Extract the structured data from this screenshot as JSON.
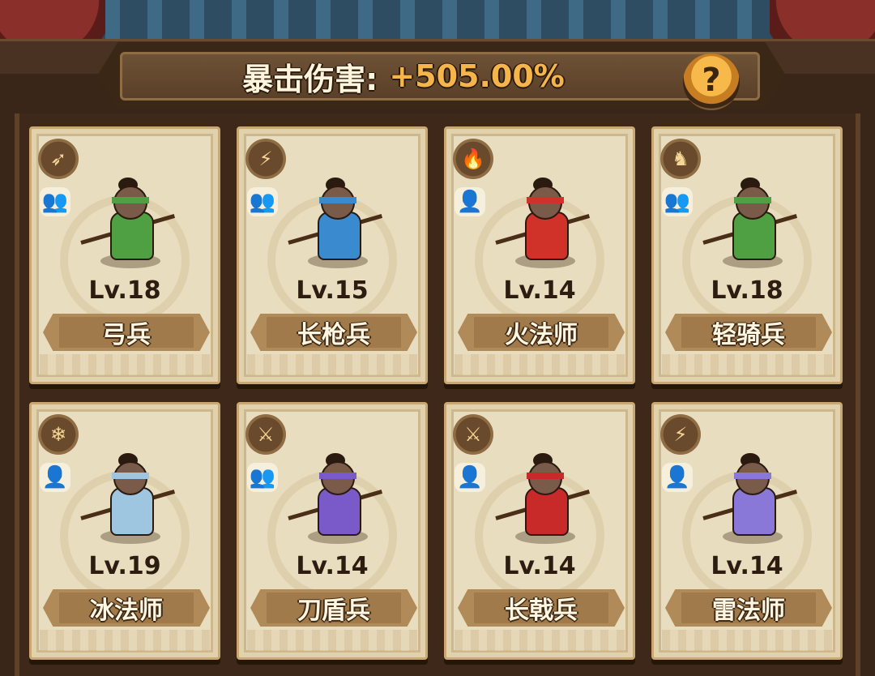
{
  "header": {
    "stat_label": "暴击伤害:",
    "stat_value": "+505.00%",
    "help_icon": "question-mark-icon",
    "help_symbol": "?"
  },
  "units": [
    {
      "level": "Lv.18",
      "name": "弓兵",
      "class_icon": "bow-icon",
      "class_symbol": "➶",
      "count_icon": "group-icon",
      "count_symbol": "👥",
      "accent": "#4fa042"
    },
    {
      "level": "Lv.15",
      "name": "长枪兵",
      "class_icon": "spear-icon",
      "class_symbol": "⚡",
      "count_icon": "group-icon",
      "count_symbol": "👥",
      "accent": "#3a8ad0"
    },
    {
      "level": "Lv.14",
      "name": "火法师",
      "class_icon": "fire-icon",
      "class_symbol": "🔥",
      "count_icon": "single-person-icon",
      "count_symbol": "👤",
      "accent": "#d0322a"
    },
    {
      "level": "Lv.18",
      "name": "轻骑兵",
      "class_icon": "horse-icon",
      "class_symbol": "♞",
      "count_icon": "group-icon",
      "count_symbol": "👥",
      "accent": "#4fa042"
    },
    {
      "level": "Lv.19",
      "name": "冰法师",
      "class_icon": "snowflake-icon",
      "class_symbol": "❄",
      "count_icon": "single-person-icon",
      "count_symbol": "👤",
      "accent": "#9ec6e0"
    },
    {
      "level": "Lv.14",
      "name": "刀盾兵",
      "class_icon": "blade-icon",
      "class_symbol": "⚔",
      "count_icon": "group-icon",
      "count_symbol": "👥",
      "accent": "#7a5ac8"
    },
    {
      "level": "Lv.14",
      "name": "长戟兵",
      "class_icon": "halberd-icon",
      "class_symbol": "⚔",
      "count_icon": "single-person-icon",
      "count_symbol": "👤",
      "accent": "#c82a2a"
    },
    {
      "level": "Lv.14",
      "name": "雷法师",
      "class_icon": "lightning-icon",
      "class_symbol": "⚡",
      "count_icon": "single-person-icon",
      "count_symbol": "👤",
      "accent": "#8a78d8"
    }
  ]
}
